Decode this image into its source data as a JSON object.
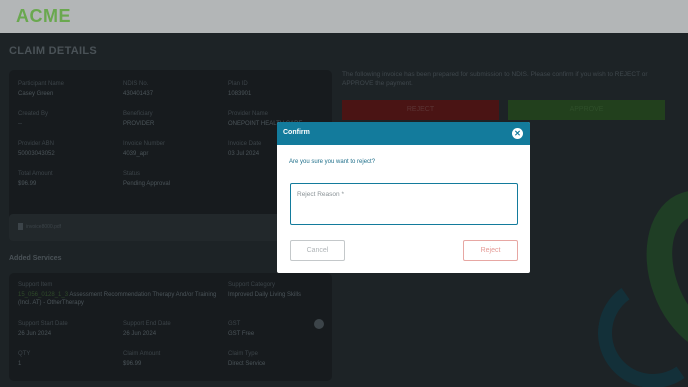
{
  "app": {
    "logo": "ACME"
  },
  "page": {
    "title": "CLAIM DETAILS"
  },
  "claim": {
    "participant_name_label": "Participant Name",
    "participant_name": "Casey Green",
    "ndis_no_label": "NDIS No.",
    "ndis_no": "430401437",
    "plan_id_label": "Plan ID",
    "plan_id": "1083901",
    "created_by_label": "Created By",
    "created_by": "--",
    "beneficiary_label": "Beneficiary",
    "beneficiary": "PROVIDER",
    "provider_name_label": "Provider Name",
    "provider_name": "ONEPOINT HEALTH CARE",
    "provider_abn_label": "Provider ABN",
    "provider_abn": "50003043052",
    "invoice_number_label": "Invoice Number",
    "invoice_number": "4039_apr",
    "invoice_date_label": "Invoice Date",
    "invoice_date": "03 Jul 2024",
    "total_amount_label": "Total Amount",
    "total_amount": "$96.99",
    "status_label": "Status",
    "status": "Pending Approval"
  },
  "attachment": {
    "filename": "invoice8000.pdf",
    "icon": "file-icon"
  },
  "services": {
    "section_title": "Added Services",
    "support_item_label": "Support Item",
    "support_item_code": "15_056_0128_1_3",
    "support_item_name": "Assessment Recommendation Therapy And/or Training (Incl. AT) - OtherTherapy",
    "support_category_label": "Support Category",
    "support_category": "Improved Daily Living Skills",
    "start_date_label": "Support Start Date",
    "start_date": "26 Jun 2024",
    "end_date_label": "Support End Date",
    "end_date": "26 Jun 2024",
    "gst_label": "GST",
    "gst": "GST Free",
    "qty_label": "QTY",
    "qty": "1",
    "claim_amount_label": "Claim Amount",
    "claim_amount": "$96.99",
    "claim_type_label": "Claim Type",
    "claim_type": "Direct Service"
  },
  "actions": {
    "instruction": "The following invoice has been prepared for submission to NDIS. Please confirm if you wish to REJECT or APPROVE the payment.",
    "reject_label": "REJECT",
    "approve_label": "APPROVE"
  },
  "modal": {
    "title": "Confirm",
    "close_icon": "close-icon",
    "question": "Are you sure you want to reject?",
    "reason_placeholder": "Reject Reason *",
    "reason_value": "",
    "cancel_label": "Cancel",
    "reject_label": "Reject"
  },
  "colors": {
    "logo": "#6aa84f",
    "modal_header": "#137b9c",
    "reject": "#c62828",
    "approve": "#4a8c3a"
  }
}
